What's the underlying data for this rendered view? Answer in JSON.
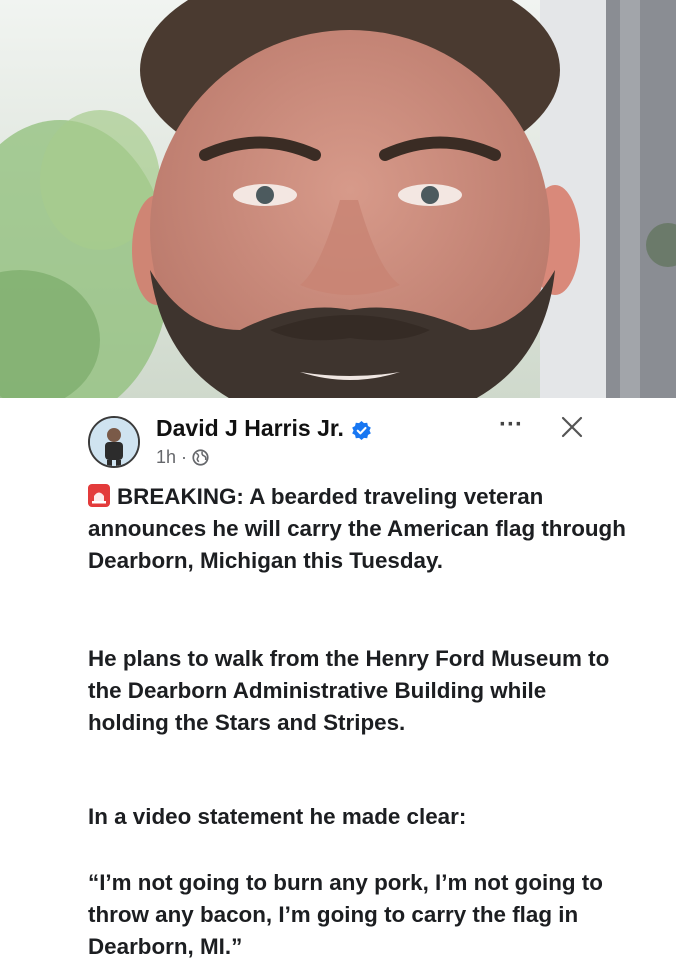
{
  "post": {
    "author_name": "David J Harris Jr.",
    "timestamp": "1h",
    "meta_separator": "·",
    "more_label": "···",
    "siren_icon": "police-light-emoji",
    "paragraphs": [
      "BREAKING: A bearded traveling veteran announces he will carry the American flag through Dearborn, Michigan this Tuesday.",
      "He plans to walk from the Henry Ford Museum to the Dearborn Administrative Building while holding the Stars and Stripes.",
      "In a video statement he made clear:",
      "“I’m not going to burn any pork, I’m not going to throw any bacon, I’m going to carry the flag in Dearborn, MI.”"
    ]
  },
  "icons": {
    "verified": "verified-badge-icon",
    "globe": "globe-icon",
    "close": "close-icon"
  },
  "colors": {
    "verified_blue": "#1877f2",
    "text": "#1c1e21",
    "meta_gray": "#65676b",
    "siren_red": "#e33b3b"
  }
}
